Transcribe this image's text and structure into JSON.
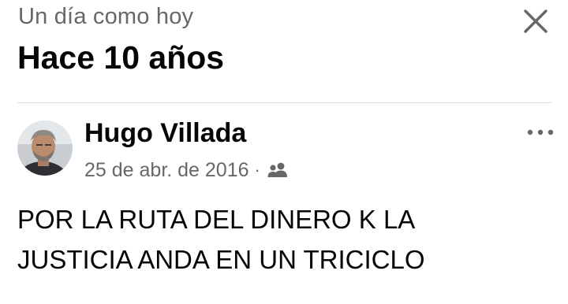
{
  "header": {
    "kicker": "Un día como hoy",
    "title": "Hace 10 años",
    "close_icon": "close-icon"
  },
  "post": {
    "author": "Hugo Villada",
    "date": "25 de abr. de 2016",
    "separator": "·",
    "audience_icon": "friends-icon",
    "more_icon": "more-options-icon",
    "text": "POR LA RUTA DEL DINERO K LA\nJUSTICIA ANDA EN UN TRICICLO"
  },
  "colors": {
    "primary_text": "#050505",
    "secondary_text": "#65676b",
    "divider": "#dadde1"
  }
}
